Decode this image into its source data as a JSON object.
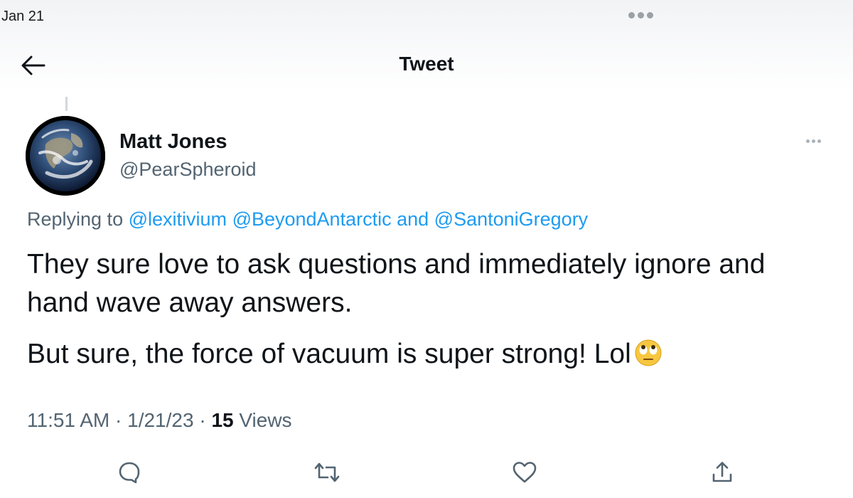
{
  "status_bar": {
    "date": "Jan 21",
    "more_icon": "ellipsis-icon"
  },
  "header": {
    "back_icon": "arrow-left-icon",
    "title": "Tweet"
  },
  "tweet": {
    "author": {
      "name": "Matt Jones",
      "handle": "@PearSpheroid",
      "avatar": "earth-globe-avatar"
    },
    "reply": {
      "prefix": "Replying to",
      "mentions": [
        "@lexitivium",
        "@BeyondAntarctic",
        "@SantoniGregory"
      ],
      "joiner": "and"
    },
    "text": {
      "paragraph_1": "They sure love to ask questions and immediately ignore and hand wave away answers.",
      "paragraph_2": "But sure, the force of vacuum is super strong! Lol",
      "emoji": "eye-roll-emoji"
    },
    "meta": {
      "time": "11:51 AM",
      "separator": "·",
      "date": "1/21/23",
      "views_count": "15",
      "views_label": "Views"
    },
    "actions": [
      {
        "name": "reply",
        "icon": "comment-icon"
      },
      {
        "name": "retweet",
        "icon": "retweet-icon"
      },
      {
        "name": "like",
        "icon": "heart-icon"
      },
      {
        "name": "share",
        "icon": "share-icon"
      }
    ]
  },
  "colors": {
    "link": "#1d9bf0",
    "secondary_text": "#536471",
    "primary_text": "#0f1419",
    "icon": "#536471"
  }
}
